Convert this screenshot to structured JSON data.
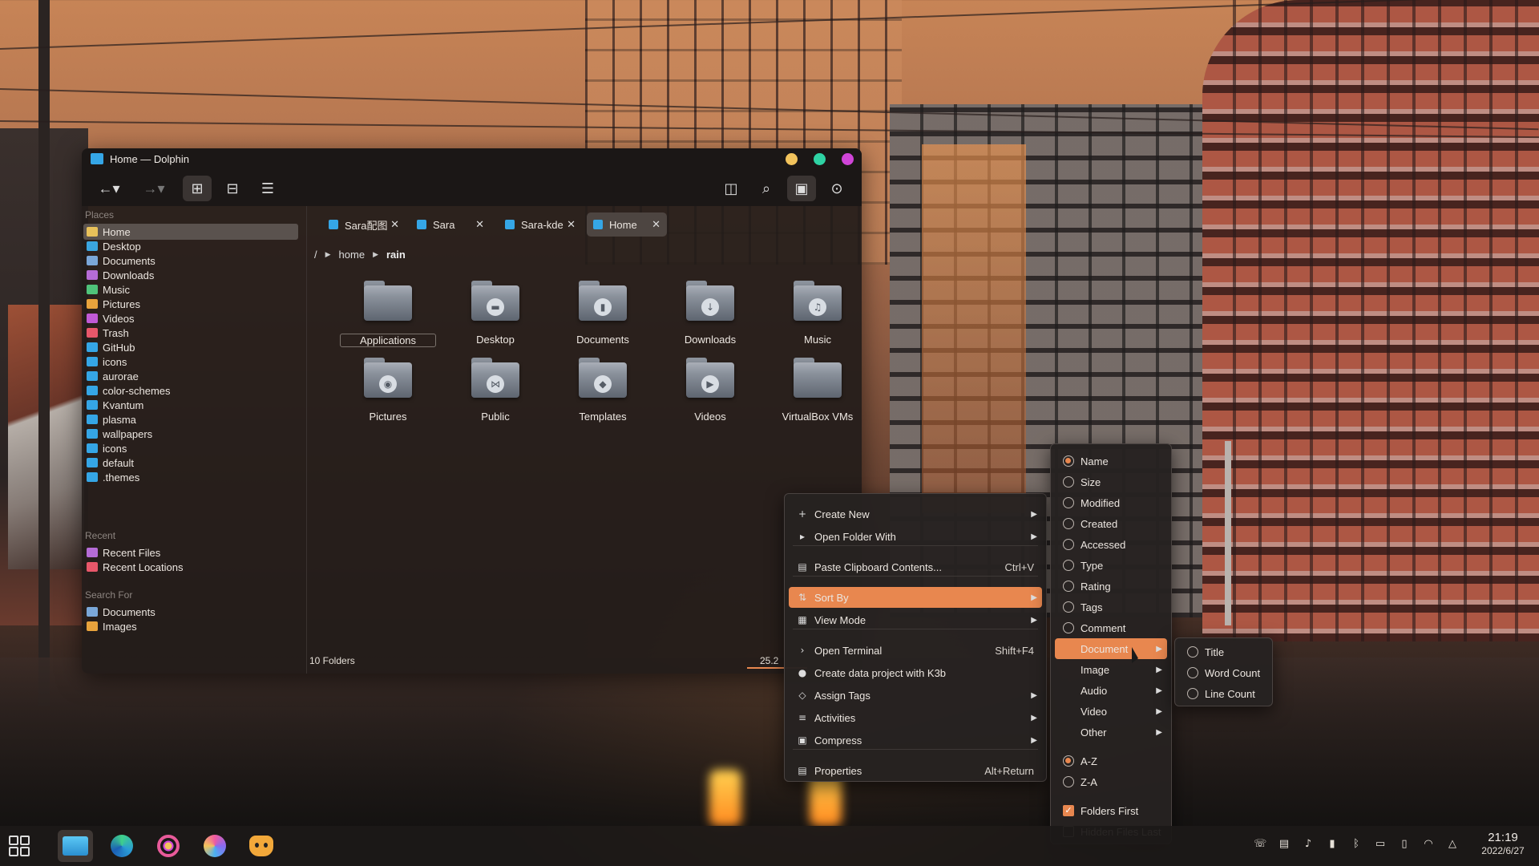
{
  "window": {
    "title": "Home — Dolphin"
  },
  "places": {
    "heading": "Places",
    "items": [
      {
        "label": "Home",
        "icon": "home-icon",
        "color": "#e8c15a"
      },
      {
        "label": "Desktop",
        "icon": "desktop-icon",
        "color": "#3aa6e0"
      },
      {
        "label": "Documents",
        "icon": "documents-icon",
        "color": "#7aa7d8"
      },
      {
        "label": "Downloads",
        "icon": "downloads-icon",
        "color": "#b56cd6"
      },
      {
        "label": "Music",
        "icon": "music-icon",
        "color": "#4fc37a"
      },
      {
        "label": "Pictures",
        "icon": "pictures-icon",
        "color": "#e8a33c"
      },
      {
        "label": "Videos",
        "icon": "videos-icon",
        "color": "#c05ad6"
      },
      {
        "label": "Trash",
        "icon": "trash-icon",
        "color": "#e8576a"
      },
      {
        "label": "GitHub",
        "icon": "folder-icon",
        "color": "#35a6e6"
      },
      {
        "label": "icons",
        "icon": "folder-icon",
        "color": "#35a6e6"
      },
      {
        "label": "aurorae",
        "icon": "folder-icon",
        "color": "#35a6e6"
      },
      {
        "label": "color-schemes",
        "icon": "folder-icon",
        "color": "#35a6e6"
      },
      {
        "label": "Kvantum",
        "icon": "folder-icon",
        "color": "#35a6e6"
      },
      {
        "label": "plasma",
        "icon": "folder-icon",
        "color": "#35a6e6"
      },
      {
        "label": "wallpapers",
        "icon": "folder-icon",
        "color": "#35a6e6"
      },
      {
        "label": "icons",
        "icon": "folder-icon",
        "color": "#35a6e6"
      },
      {
        "label": "default",
        "icon": "folder-icon",
        "color": "#35a6e6"
      },
      {
        "label": ".themes",
        "icon": "folder-icon",
        "color": "#35a6e6"
      }
    ]
  },
  "recent": {
    "heading": "Recent",
    "items": [
      {
        "label": "Recent Files",
        "icon": "recent-files-icon",
        "color": "#b56cd6"
      },
      {
        "label": "Recent Locations",
        "icon": "recent-locations-icon",
        "color": "#e8576a"
      }
    ]
  },
  "search_for": {
    "heading": "Search For",
    "items": [
      {
        "label": "Documents",
        "icon": "documents-icon",
        "color": "#7aa7d8"
      },
      {
        "label": "Images",
        "icon": "images-icon",
        "color": "#e8a33c"
      }
    ]
  },
  "tabs": [
    {
      "label": "Sara配图",
      "active": false
    },
    {
      "label": "Sara",
      "active": false
    },
    {
      "label": "Sara-kde",
      "active": false
    },
    {
      "label": "Home",
      "active": true
    }
  ],
  "breadcrumb": [
    "/",
    "home",
    "rain"
  ],
  "folders": [
    {
      "label": "Applications",
      "glyph": "",
      "selected": true
    },
    {
      "label": "Desktop",
      "glyph": "▬"
    },
    {
      "label": "Documents",
      "glyph": "▮"
    },
    {
      "label": "Downloads",
      "glyph": "↓"
    },
    {
      "label": "Music",
      "glyph": "♫"
    },
    {
      "label": "Pictures",
      "glyph": "◉"
    },
    {
      "label": "Public",
      "glyph": "⋈"
    },
    {
      "label": "Templates",
      "glyph": "◆"
    },
    {
      "label": "Videos",
      "glyph": "▶"
    },
    {
      "label": "VirtualBox VMs",
      "glyph": ""
    }
  ],
  "status": {
    "count": "10 Folders",
    "free": "25.2"
  },
  "context_menu": {
    "items": [
      {
        "label": "Create New",
        "icon": "+",
        "submenu": true
      },
      {
        "label": "Open Folder With",
        "icon": "▸",
        "submenu": true
      },
      {
        "label": "Paste Clipboard Contents...",
        "icon": "▤",
        "shortcut": "Ctrl+V"
      },
      {
        "label": "Sort By",
        "icon": "⇅",
        "submenu": true,
        "highlighted": true
      },
      {
        "label": "View Mode",
        "icon": "▦",
        "submenu": true
      },
      {
        "label": "Open Terminal",
        "icon": "›",
        "shortcut": "Shift+F4"
      },
      {
        "label": "Create data project with K3b",
        "icon": "●"
      },
      {
        "label": "Assign Tags",
        "icon": "◇",
        "submenu": true
      },
      {
        "label": "Activities",
        "icon": "≡",
        "submenu": true
      },
      {
        "label": "Compress",
        "icon": "▣",
        "submenu": true
      },
      {
        "label": "Properties",
        "icon": "▤",
        "shortcut": "Alt+Return"
      }
    ]
  },
  "sort_menu": {
    "fields": [
      {
        "label": "Name",
        "selected": true
      },
      {
        "label": "Size"
      },
      {
        "label": "Modified"
      },
      {
        "label": "Created"
      },
      {
        "label": "Accessed"
      },
      {
        "label": "Type"
      },
      {
        "label": "Rating"
      },
      {
        "label": "Tags"
      },
      {
        "label": "Comment"
      }
    ],
    "submenus": [
      {
        "label": "Document",
        "highlighted": true
      },
      {
        "label": "Image"
      },
      {
        "label": "Audio"
      },
      {
        "label": "Video"
      },
      {
        "label": "Other"
      }
    ],
    "order": [
      {
        "label": "A-Z",
        "selected": true
      },
      {
        "label": "Z-A"
      }
    ],
    "options": [
      {
        "label": "Folders First",
        "checked": true
      },
      {
        "label": "Hidden Files Last",
        "checked": false
      }
    ]
  },
  "document_menu": [
    {
      "label": "Title"
    },
    {
      "label": "Word Count"
    },
    {
      "label": "Line Count"
    }
  ],
  "taskbar": {
    "apps": [
      "app-launcher-icon",
      "dolphin-icon",
      "edge-browser-icon",
      "media-player-icon",
      "discover-icon",
      "cat-app-icon"
    ],
    "time": "21:19",
    "date": "2022/6/27"
  },
  "colors": {
    "accent": "#e8874f",
    "title_close": "#d045d8",
    "title_max": "#2fd3a4",
    "title_min": "#f2c35c"
  }
}
